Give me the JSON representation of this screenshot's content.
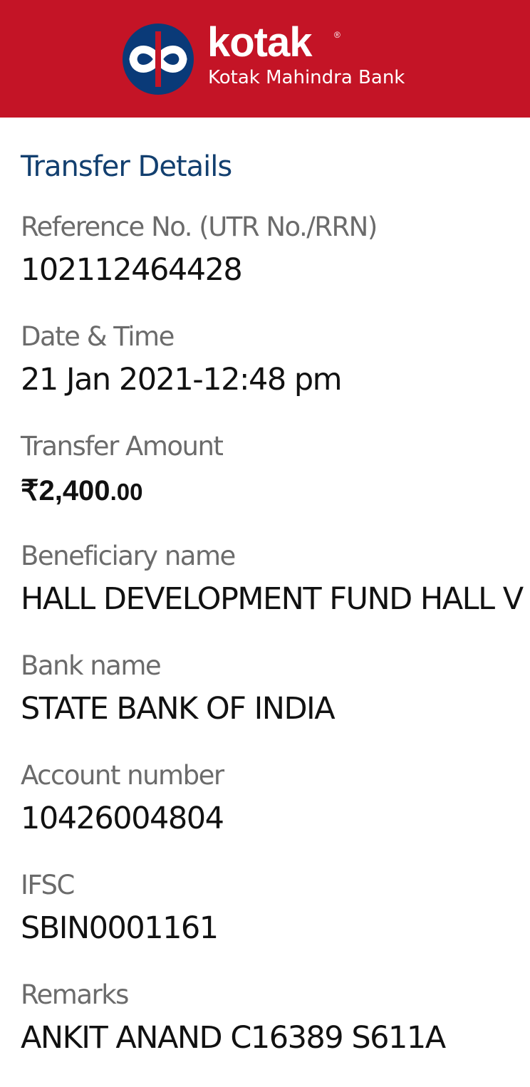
{
  "header": {
    "brand_word": "kotak",
    "registered_mark": "®",
    "brand_name": "Kotak Mahindra Bank",
    "brand_color": "#c41426",
    "logo_icon": "kotak-infinity-logo-icon"
  },
  "details": {
    "title": "Transfer Details",
    "reference": {
      "label": "Reference No. (UTR No./RRN)",
      "value": "102112464428"
    },
    "datetime": {
      "label": "Date & Time",
      "value": "21 Jan 2021-12:48 pm"
    },
    "amount": {
      "label": "Transfer Amount",
      "currency": "₹",
      "main": "2,400",
      "decimal": ".00"
    },
    "beneficiary": {
      "label": "Beneficiary name",
      "value": "HALL DEVELOPMENT FUND HALL V"
    },
    "bank": {
      "label": "Bank name",
      "value": "STATE BANK OF INDIA"
    },
    "account": {
      "label": "Account number",
      "value": "10426004804"
    },
    "ifsc": {
      "label": "IFSC",
      "value": "SBIN0001161"
    },
    "remarks": {
      "label": "Remarks",
      "value": "ANKIT ANAND C16389 S611A"
    }
  }
}
